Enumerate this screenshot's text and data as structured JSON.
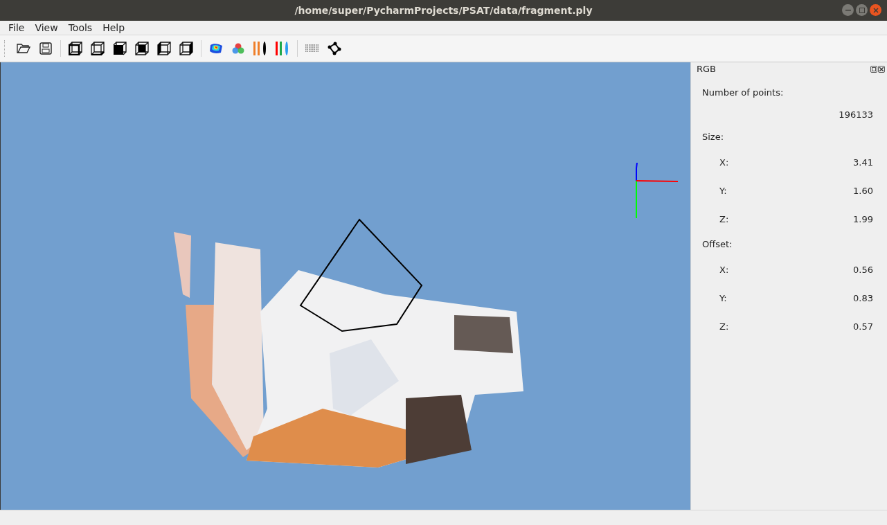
{
  "window": {
    "title": "/home/super/PycharmProjects/PSAT/data/fragment.ply"
  },
  "menu": [
    "File",
    "View",
    "Tools",
    "Help"
  ],
  "panel": {
    "title": "RGB",
    "rows": [
      {
        "kind": "heading",
        "label": "Number of points:"
      },
      {
        "kind": "value",
        "value": "196133"
      },
      {
        "kind": "heading",
        "label": "Size:"
      },
      {
        "kind": "pair",
        "label": "X:",
        "value": "3.41"
      },
      {
        "kind": "pair",
        "label": "Y:",
        "value": "1.60"
      },
      {
        "kind": "pair",
        "label": "Z:",
        "value": "1.99"
      },
      {
        "kind": "heading",
        "label": "Offset:"
      },
      {
        "kind": "pair",
        "label": "X:",
        "value": "0.56"
      },
      {
        "kind": "pair",
        "label": "Y:",
        "value": "0.83"
      },
      {
        "kind": "pair",
        "label": "Z:",
        "value": "0.57"
      }
    ]
  }
}
